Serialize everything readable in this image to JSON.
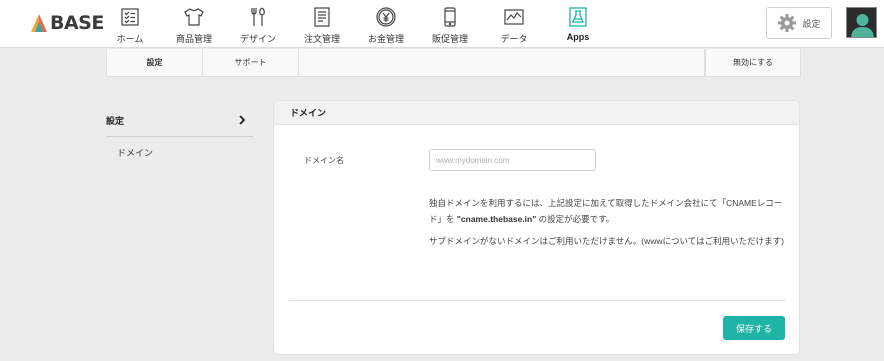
{
  "brand": {
    "name": "BASE",
    "accent": "#1fb4a5"
  },
  "nav": [
    {
      "label": "ホーム",
      "icon": "checklist-icon"
    },
    {
      "label": "商品管理",
      "icon": "tshirt-icon"
    },
    {
      "label": "デザイン",
      "icon": "tools-icon"
    },
    {
      "label": "注文管理",
      "icon": "document-icon"
    },
    {
      "label": "お金管理",
      "icon": "yen-coin-icon"
    },
    {
      "label": "販促管理",
      "icon": "smartphone-icon"
    },
    {
      "label": "データ",
      "icon": "line-chart-icon"
    },
    {
      "label": "Apps",
      "icon": "flask-icon",
      "active": true
    }
  ],
  "header": {
    "settings_label": "設定"
  },
  "subtabs": {
    "settings": "設定",
    "support": "サポート",
    "disable": "無効にする"
  },
  "sidebar": {
    "heading": "設定",
    "items": [
      {
        "label": "ドメイン"
      }
    ]
  },
  "panel": {
    "title": "ドメイン",
    "domain_label": "ドメイン名",
    "domain_placeholder": "www.mydomain.com",
    "domain_value": "",
    "desc1_pre": "独自ドメインを利用するには、上記設定に加えて取得したドメイン会社にて「CNAMEレコード」を ",
    "desc1_strong": "\"cname.thebase.in\"",
    "desc1_post": " の設定が必要です。",
    "desc2": "サブドメインがないドメインはご利用いただけません。(wwwについてはご利用いただけます)",
    "save_label": "保存する"
  }
}
